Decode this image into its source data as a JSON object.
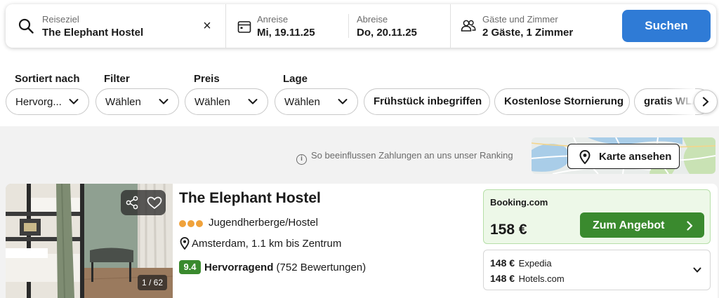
{
  "search": {
    "destination_label": "Reiseziel",
    "destination_value": "The Elephant Hostel",
    "clear_glyph": "×",
    "checkin_label": "Anreise",
    "checkin_value": "Mi, 19.11.25",
    "checkout_label": "Abreise",
    "checkout_value": "Do, 20.11.25",
    "guests_label": "Gäste und Zimmer",
    "guests_value": "2 Gäste, 1 Zimmer",
    "search_button": "Suchen",
    "button_color": "#2f7bd6"
  },
  "filters": {
    "sort_label": "Sortiert nach",
    "sort_value": "Hervorg...",
    "filter_label": "Filter",
    "filter_value": "Wählen",
    "price_label": "Preis",
    "price_value": "Wählen",
    "location_label": "Lage",
    "location_value": "Wählen",
    "chips": [
      "Frühstück inbegriffen",
      "Kostenlose Stornierung",
      "gratis WLAN"
    ]
  },
  "ranking_info": "So beeinflussen Zahlungen an uns unser Ranking",
  "map": {
    "button_label": "Karte ansehen"
  },
  "hotel": {
    "name": "The Elephant Hostel",
    "stars": 3,
    "type": "Jugendherberge/Hostel",
    "location": "Amsterdam, 1.1 km bis Zentrum",
    "rating_score": "9.4",
    "rating_label": "Hervorragend",
    "review_count": "(752 Bewertungen)",
    "image_counter": "1 / 62",
    "rating_color": "#3a8a2e"
  },
  "offer": {
    "provider": "Booking.com",
    "price": "158 €",
    "deal_button": "Zum Angebot",
    "alternatives": [
      {
        "price": "148 €",
        "provider": "Expedia"
      },
      {
        "price": "148 €",
        "provider": "Hotels.com"
      }
    ]
  }
}
